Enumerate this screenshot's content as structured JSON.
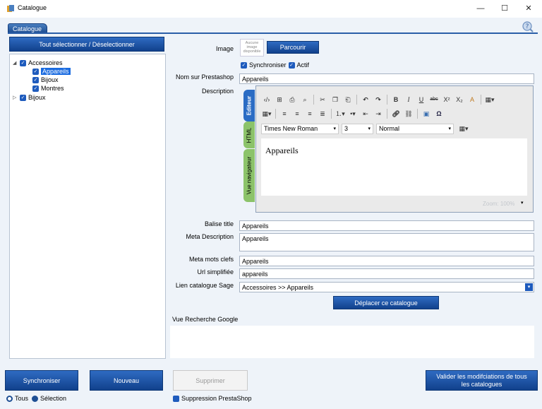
{
  "window": {
    "title": "Catalogue",
    "minimize": "—",
    "maximize": "☐",
    "close": "✕"
  },
  "tab": {
    "label": "Catalogue"
  },
  "left_panel": {
    "select_all_label": "Tout sélectionner / Déselectionner",
    "tree": [
      {
        "label": "Accessoires",
        "expander": "◢"
      },
      {
        "label": "Appareils"
      },
      {
        "label": "Bijoux"
      },
      {
        "label": "Montres"
      },
      {
        "label": "Bijoux",
        "expander": "▷"
      }
    ]
  },
  "form": {
    "image_label": "Image",
    "image_placeholder": "Aucune image disponible",
    "browse_label": "Parcourir",
    "sync_label": "Synchroniser",
    "active_label": "Actif",
    "prestashop_name_label": "Nom sur Prestashop",
    "prestashop_name_value": "Appareils",
    "description_label": "Description",
    "balise_title_label": "Balise title",
    "balise_title_value": "Appareils",
    "meta_description_label": "Meta Description",
    "meta_description_value": "Appareils",
    "meta_keywords_label": "Meta mots clefs",
    "meta_keywords_value": "Appareils",
    "url_label": "Url simplifiée",
    "url_value": "appareils",
    "sage_link_label": "Lien catalogue Sage",
    "sage_link_value": "Accessoires >> Appareils",
    "move_button": "Déplacer ce catalogue",
    "google_preview_label": "Vue Recherche Google"
  },
  "editor": {
    "tabs": [
      "Editeur",
      "HTML",
      "Vue navigateur"
    ],
    "font_name": "Times New Roman",
    "font_size": "3",
    "paragraph_style": "Normal",
    "content": "Appareils",
    "zoom": "Zoom: 100%"
  },
  "bottom": {
    "sync_button": "Synchroniser",
    "new_button": "Nouveau",
    "delete_button": "Supprimer",
    "validate_button": "Valider les modifciations de tous les catalogues",
    "radio_all": "Tous",
    "radio_selection": "Sélection",
    "prestashop_delete_label": "Suppression PrestaShop"
  },
  "colors": {
    "accent_blue": "#1e4f94",
    "checkbox_blue": "#1e5bbd",
    "selection_blue": "#1a6be0",
    "editor_tab_blue": "#2b6cc4",
    "editor_tab_green": "#8cc36a",
    "panel_bg": "#eef3f9"
  }
}
